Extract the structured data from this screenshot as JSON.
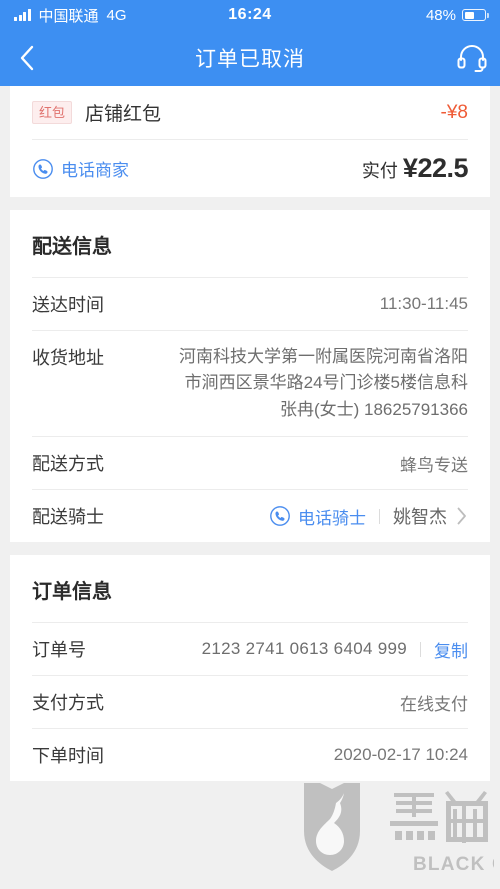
{
  "status_bar": {
    "carrier": "中国联通",
    "network": "4G",
    "time": "16:24",
    "battery_percent": "48%",
    "battery_level": 48,
    "signal_icon": "signal-bars-icon",
    "battery_icon": "battery-icon"
  },
  "nav": {
    "title": "订单已取消",
    "back_icon": "chevron-left-icon",
    "service_icon": "headset-icon"
  },
  "colors": {
    "brand_blue": "#3d8ff2",
    "link_blue": "#4a8def",
    "price_orange": "#ef5b36",
    "badge_bg": "#fdeeee",
    "badge_text": "#e0726e",
    "page_bg": "#f0f0f0"
  },
  "price_card": {
    "red_packet": {
      "badge": "红包",
      "name": "店铺红包",
      "amount": "-¥8"
    },
    "call_merchant": {
      "label": "电话商家",
      "icon": "phone-circle-icon"
    },
    "pay": {
      "label": "实付",
      "amount": "¥22.5"
    }
  },
  "delivery": {
    "title": "配送信息",
    "rows": [
      {
        "label": "送达时间",
        "value": "11:30-11:45"
      },
      {
        "label": "收货地址",
        "value": "河南科技大学第一附属医院河南省洛阳市涧西区景华路24号门诊楼5楼信息科\n张冉(女士) 18625791366"
      },
      {
        "label": "配送方式",
        "value": "蜂鸟专送"
      }
    ],
    "rider": {
      "label": "配送骑士",
      "call_label": "电话骑士",
      "call_icon": "phone-circle-icon",
      "name": "姚智杰",
      "chevron_icon": "chevron-right-icon"
    }
  },
  "order": {
    "title": "订单信息",
    "number_label": "订单号",
    "number_value": "2123 2741 0613 6404 999",
    "copy_label": "复制",
    "rows": [
      {
        "label": "支付方式",
        "value": "在线支付"
      },
      {
        "label": "下单时间",
        "value": "2020-02-17 10:24"
      }
    ]
  },
  "watermark": {
    "cn": "黑猫",
    "en": "BLACK CAT",
    "icon": "black-cat-shield-icon"
  }
}
